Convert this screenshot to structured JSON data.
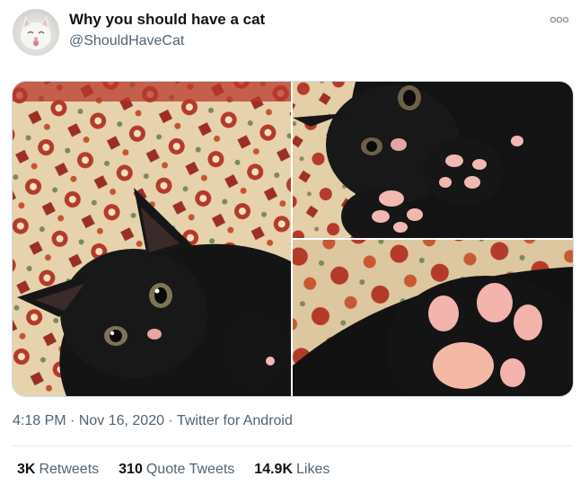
{
  "tweet": {
    "display_name": "Why you should have a cat",
    "handle": "@ShouldHaveCat",
    "time": "4:18 PM",
    "sep1": " · ",
    "date": "Nov 16, 2020",
    "sep2": " · ",
    "source": "Twitter for Android"
  },
  "stats": [
    {
      "count": "3K",
      "label": "Retweets"
    },
    {
      "count": "310",
      "label": "Quote Tweets"
    },
    {
      "count": "14.9K",
      "label": "Likes"
    }
  ],
  "media": {
    "photos": [
      "black-kitten-lying-on-rug",
      "kitten-holding-paws-up",
      "pink-toe-beans-closeup"
    ]
  },
  "colors": {
    "text_primary": "#0f1419",
    "text_secondary": "#536471",
    "border": "#cfd9de",
    "rug_red": "#b43a2a",
    "rug_cream": "#e8d6b0",
    "fur": "#151515",
    "paw_pink": "#f2b8b2"
  },
  "icons": [
    "more-options-icon"
  ]
}
